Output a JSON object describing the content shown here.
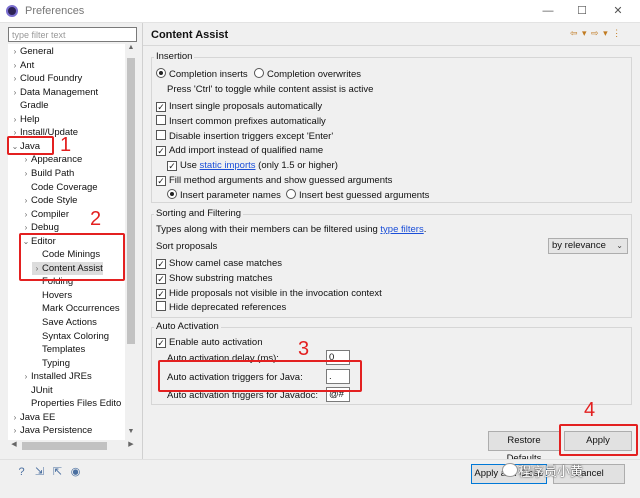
{
  "window": {
    "title": "Preferences",
    "controls": {
      "minimize": "—",
      "maximize": "☐",
      "close": "✕"
    }
  },
  "left": {
    "filter_placeholder": "type filter text",
    "tree": [
      {
        "label": "General",
        "twisty": "›",
        "indent": 0
      },
      {
        "label": "Ant",
        "twisty": "›",
        "indent": 0
      },
      {
        "label": "Cloud Foundry",
        "twisty": "›",
        "indent": 0
      },
      {
        "label": "Data Management",
        "twisty": "›",
        "indent": 0
      },
      {
        "label": "Gradle",
        "twisty": "",
        "indent": 0
      },
      {
        "label": "Help",
        "twisty": "›",
        "indent": 0
      },
      {
        "label": "Install/Update",
        "twisty": "›",
        "indent": 0
      },
      {
        "label": "Java",
        "twisty": "⌄",
        "indent": 0
      },
      {
        "label": "Appearance",
        "twisty": "›",
        "indent": 1
      },
      {
        "label": "Build Path",
        "twisty": "›",
        "indent": 1
      },
      {
        "label": "Code Coverage",
        "twisty": "",
        "indent": 1
      },
      {
        "label": "Code Style",
        "twisty": "›",
        "indent": 1
      },
      {
        "label": "Compiler",
        "twisty": "›",
        "indent": 1
      },
      {
        "label": "Debug",
        "twisty": "›",
        "indent": 1
      },
      {
        "label": "Editor",
        "twisty": "⌄",
        "indent": 1
      },
      {
        "label": "Code Minings",
        "twisty": "",
        "indent": 2
      },
      {
        "label": "Content Assist",
        "twisty": "›",
        "indent": 2,
        "selected": true
      },
      {
        "label": "Folding",
        "twisty": "",
        "indent": 2
      },
      {
        "label": "Hovers",
        "twisty": "",
        "indent": 2
      },
      {
        "label": "Mark Occurrences",
        "twisty": "",
        "indent": 2
      },
      {
        "label": "Save Actions",
        "twisty": "",
        "indent": 2
      },
      {
        "label": "Syntax Coloring",
        "twisty": "",
        "indent": 2
      },
      {
        "label": "Templates",
        "twisty": "",
        "indent": 2
      },
      {
        "label": "Typing",
        "twisty": "",
        "indent": 2
      },
      {
        "label": "Installed JREs",
        "twisty": "›",
        "indent": 1
      },
      {
        "label": "JUnit",
        "twisty": "",
        "indent": 1
      },
      {
        "label": "Properties Files Edito",
        "twisty": "",
        "indent": 1
      },
      {
        "label": "Java EE",
        "twisty": "›",
        "indent": 0
      },
      {
        "label": "Java Persistence",
        "twisty": "›",
        "indent": 0
      }
    ]
  },
  "page": {
    "title": "Content Assist",
    "nav": "⇦ ▾ ⇨ ▾ ⋮",
    "insertion": {
      "label": "Insertion",
      "completion_inserts": "Completion inserts",
      "completion_overwrites": "Completion overwrites",
      "toggle_hint": "Press 'Ctrl' to toggle while content assist is active",
      "single_proposals": "Insert single proposals automatically",
      "common_prefixes": "Insert common prefixes automatically",
      "disable_triggers": "Disable insertion triggers except 'Enter'",
      "add_import": "Add import instead of qualified name",
      "use": "Use",
      "static_imports": "static imports",
      "static_suffix": " (only 1.5 or higher)",
      "fill_method": "Fill method arguments and show guessed arguments",
      "insert_param_names": "Insert parameter names",
      "insert_best_guessed": "Insert best guessed arguments"
    },
    "sorting": {
      "label": "Sorting and Filtering",
      "types_text": "Types along with their members can be filtered using ",
      "type_filters": "type filters",
      "types_end": ".",
      "sort_proposals": "Sort proposals",
      "sort_value": "by relevance",
      "camel_case": "Show camel case matches",
      "substring": "Show substring matches",
      "hide_not_visible": "Hide proposals not visible in the invocation context",
      "hide_deprecated": "Hide deprecated references"
    },
    "auto": {
      "label": "Auto Activation",
      "enable": "Enable auto activation",
      "delay_label": "Auto activation delay (ms):",
      "delay_value": "0",
      "java_label": "Auto activation triggers for Java:",
      "java_value": ".",
      "javadoc_label": "Auto activation triggers for Javadoc:",
      "javadoc_value": "@#"
    },
    "checks": {
      "on": "✓"
    },
    "buttons": {
      "restore": "Restore Defaults",
      "apply": "Apply"
    }
  },
  "bottom": {
    "apply_close": "Apply and Close",
    "cancel": "Cancel",
    "icons": [
      "help-icon",
      "import-icon",
      "export-icon",
      "record-icon"
    ],
    "icon_glyphs": [
      "?",
      "⇲",
      "⇱",
      "◉"
    ]
  },
  "annotations": [
    "1",
    "2",
    "3",
    "4"
  ],
  "watermark": "程序员小黄",
  "colors": {
    "annotation": "#e32020",
    "link": "#1b4fd8",
    "default_button": "#0078d7"
  }
}
